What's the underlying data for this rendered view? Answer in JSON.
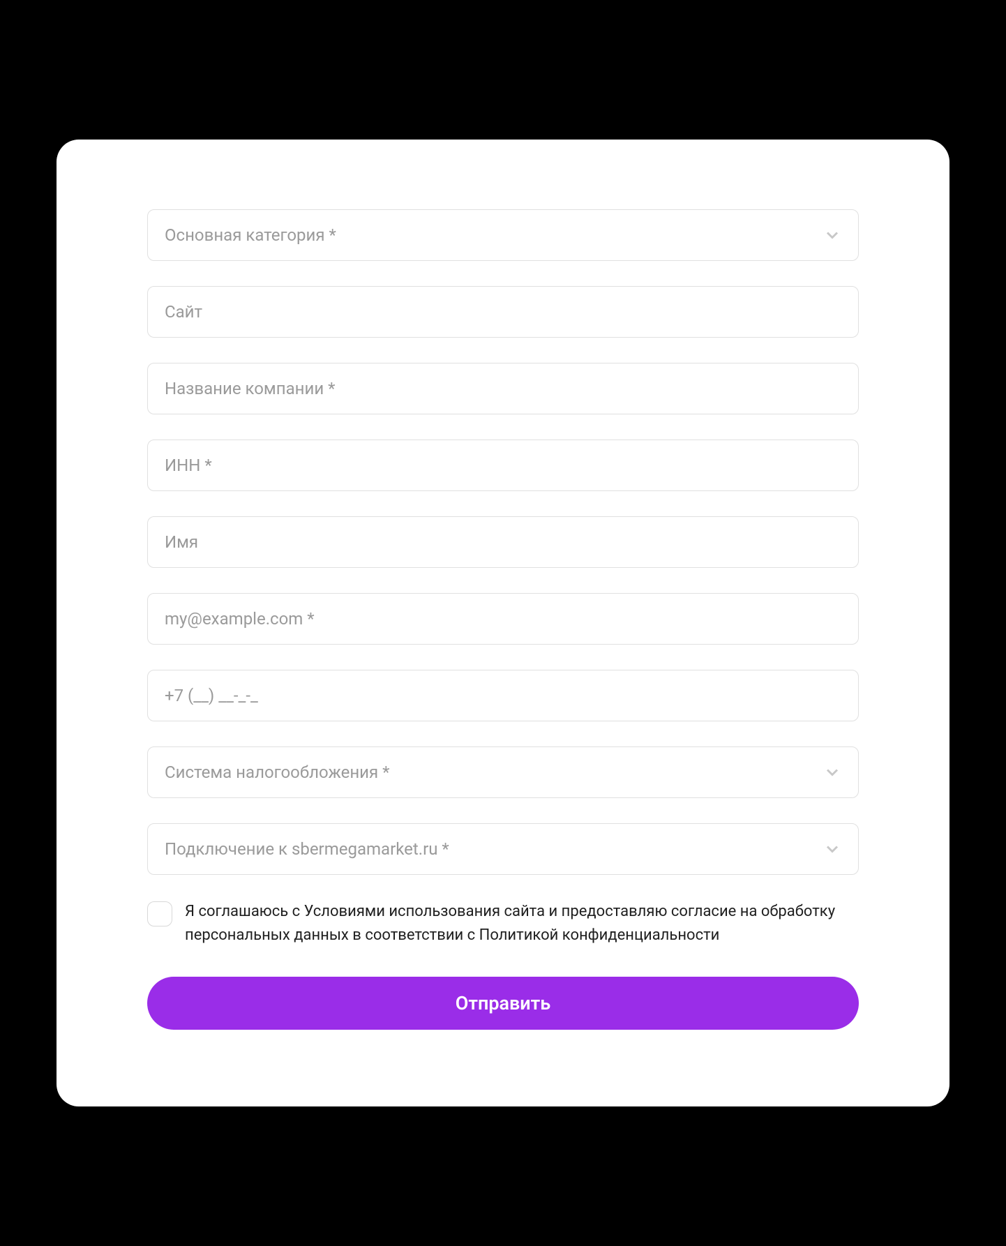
{
  "form": {
    "category": {
      "placeholder": "Основная категория *"
    },
    "website": {
      "placeholder": "Сайт"
    },
    "company": {
      "placeholder": "Название компании *"
    },
    "inn": {
      "placeholder": "ИНН *"
    },
    "name": {
      "placeholder": "Имя"
    },
    "email": {
      "placeholder": "my@example.com *"
    },
    "phone": {
      "placeholder": "+7 (__) __-_-_"
    },
    "tax_system": {
      "placeholder": "Система налогообложения *"
    },
    "connection": {
      "placeholder": "Подключение к sbermegamarket.ru *"
    },
    "consent": {
      "text": "Я соглашаюсь с Условиями использования сайта и предоставляю согласие на обработку персональных данных в соответствии с Политикой конфиденциальности"
    },
    "submit": {
      "label": "Отправить"
    }
  },
  "colors": {
    "accent": "#9a2de8",
    "border": "#e0e0e0",
    "placeholder": "#9a9a9a"
  }
}
